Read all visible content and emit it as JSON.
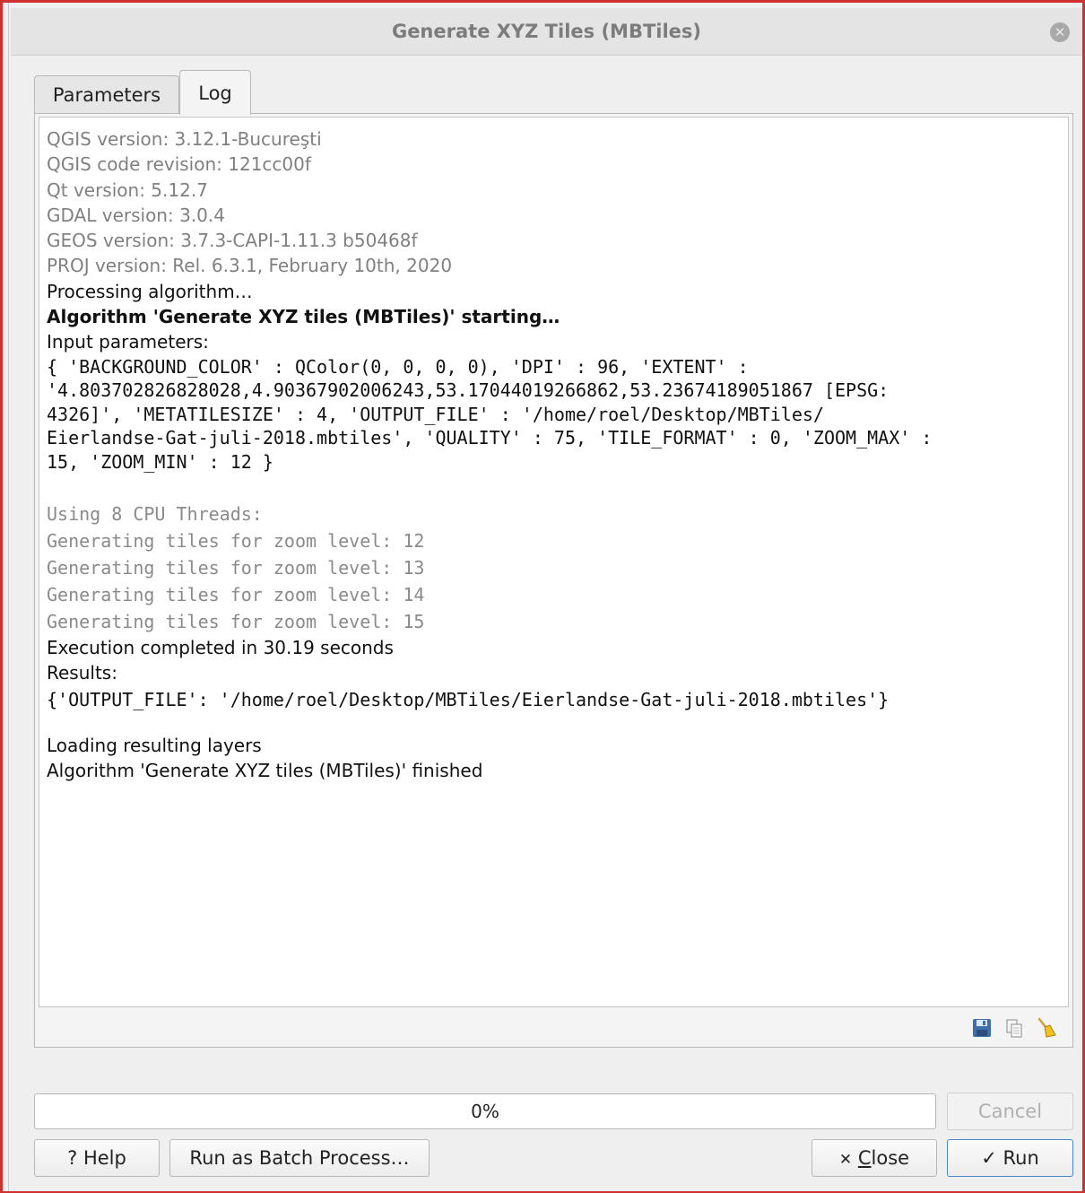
{
  "window": {
    "title": "Generate XYZ Tiles (MBTiles)"
  },
  "tabs": [
    {
      "label": "Parameters",
      "active": false
    },
    {
      "label": "Log",
      "active": true
    }
  ],
  "log": {
    "version_lines": [
      "QGIS version: 3.12.1-Bucureşti",
      "QGIS code revision: 121cc00f",
      "Qt version: 5.12.7",
      "GDAL version: 3.0.4",
      "GEOS version: 3.7.3-CAPI-1.11.3 b50468f",
      "PROJ version: Rel. 6.3.1, February 10th, 2020"
    ],
    "processing": "Processing algorithm…",
    "starting": "Algorithm 'Generate XYZ tiles (MBTiles)' starting…",
    "input_params_label": "Input parameters:",
    "params_lines": [
      "{ 'BACKGROUND_COLOR' : QColor(0, 0, 0, 0), 'DPI' : 96, 'EXTENT' :",
      "'4.803702826828028,4.90367902006243,53.17044019266862,53.23674189051867 [EPSG:",
      "4326]', 'METATILESIZE' : 4, 'OUTPUT_FILE' : '/home/roel/Desktop/MBTiles/",
      "Eierlandse-Gat-juli-2018.mbtiles', 'QUALITY' : 75, 'TILE_FORMAT' : 0, 'ZOOM_MAX' :",
      "15, 'ZOOM_MIN' : 12 }"
    ],
    "thread_lines": [
      "Using 8 CPU Threads:",
      "Generating tiles for zoom level: 12",
      "Generating tiles for zoom level: 13",
      "Generating tiles for zoom level: 14",
      "Generating tiles for zoom level: 15"
    ],
    "execution": "Execution completed in 30.19 seconds",
    "results_label": "Results:",
    "results_value": "{'OUTPUT_FILE': '/home/roel/Desktop/MBTiles/Eierlandse-Gat-juli-2018.mbtiles'}",
    "loading": "Loading resulting layers",
    "finished": "Algorithm 'Generate XYZ tiles (MBTiles)' finished"
  },
  "log_tools": {
    "icons": [
      "save-icon",
      "copy-icon",
      "clear-icon"
    ]
  },
  "progress": {
    "text": "0%",
    "value": 0
  },
  "buttons": {
    "cancel": "Cancel",
    "help_glyph": "?",
    "help": "Help",
    "batch": "Run as Batch Process…",
    "close_glyph": "✕",
    "close_mnemonic": "C",
    "close_rest": "lose",
    "run_glyph": "✓",
    "run": "Run"
  },
  "colors": {
    "accent": "#4a86c8",
    "frame": "#d03030"
  }
}
